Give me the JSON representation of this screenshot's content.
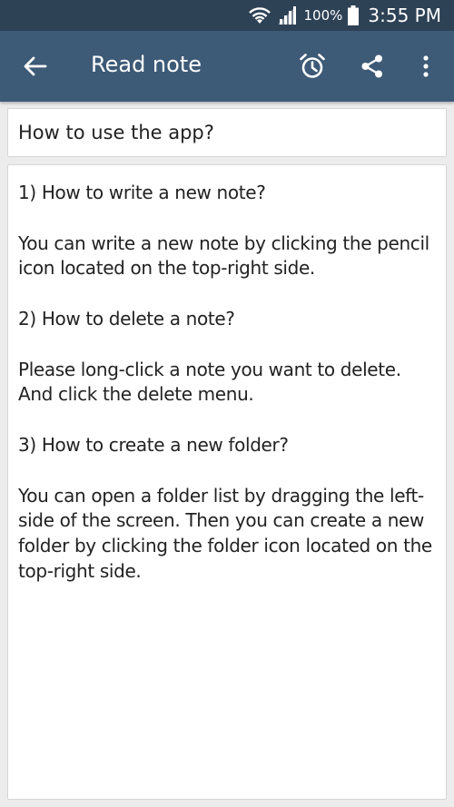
{
  "status_bar": {
    "battery_percent": "100%",
    "time": "3:55 PM",
    "icons": [
      "wifi-icon",
      "signal-icon",
      "battery-icon"
    ]
  },
  "app_bar": {
    "title": "Read note",
    "icons": [
      "back-arrow-icon",
      "alarm-clock-icon",
      "share-icon",
      "more-vertical-icon"
    ]
  },
  "note": {
    "title": "How to use the app?",
    "body": "1) How to write a new note?\n\nYou can write a new note by clicking the pencil icon located on the top-right side.\n\n2) How to delete a note?\n\nPlease long-click a note you want to delete. And click the delete menu.\n\n3) How to create a new folder?\n\nYou can open a folder list by dragging the left-side of the screen. Then you can create a new folder by clicking the folder icon located on the top-right side."
  },
  "colors": {
    "status_bar": "#2e4256",
    "app_bar": "#3d5a77",
    "background": "#ececec",
    "card": "#ffffff"
  }
}
